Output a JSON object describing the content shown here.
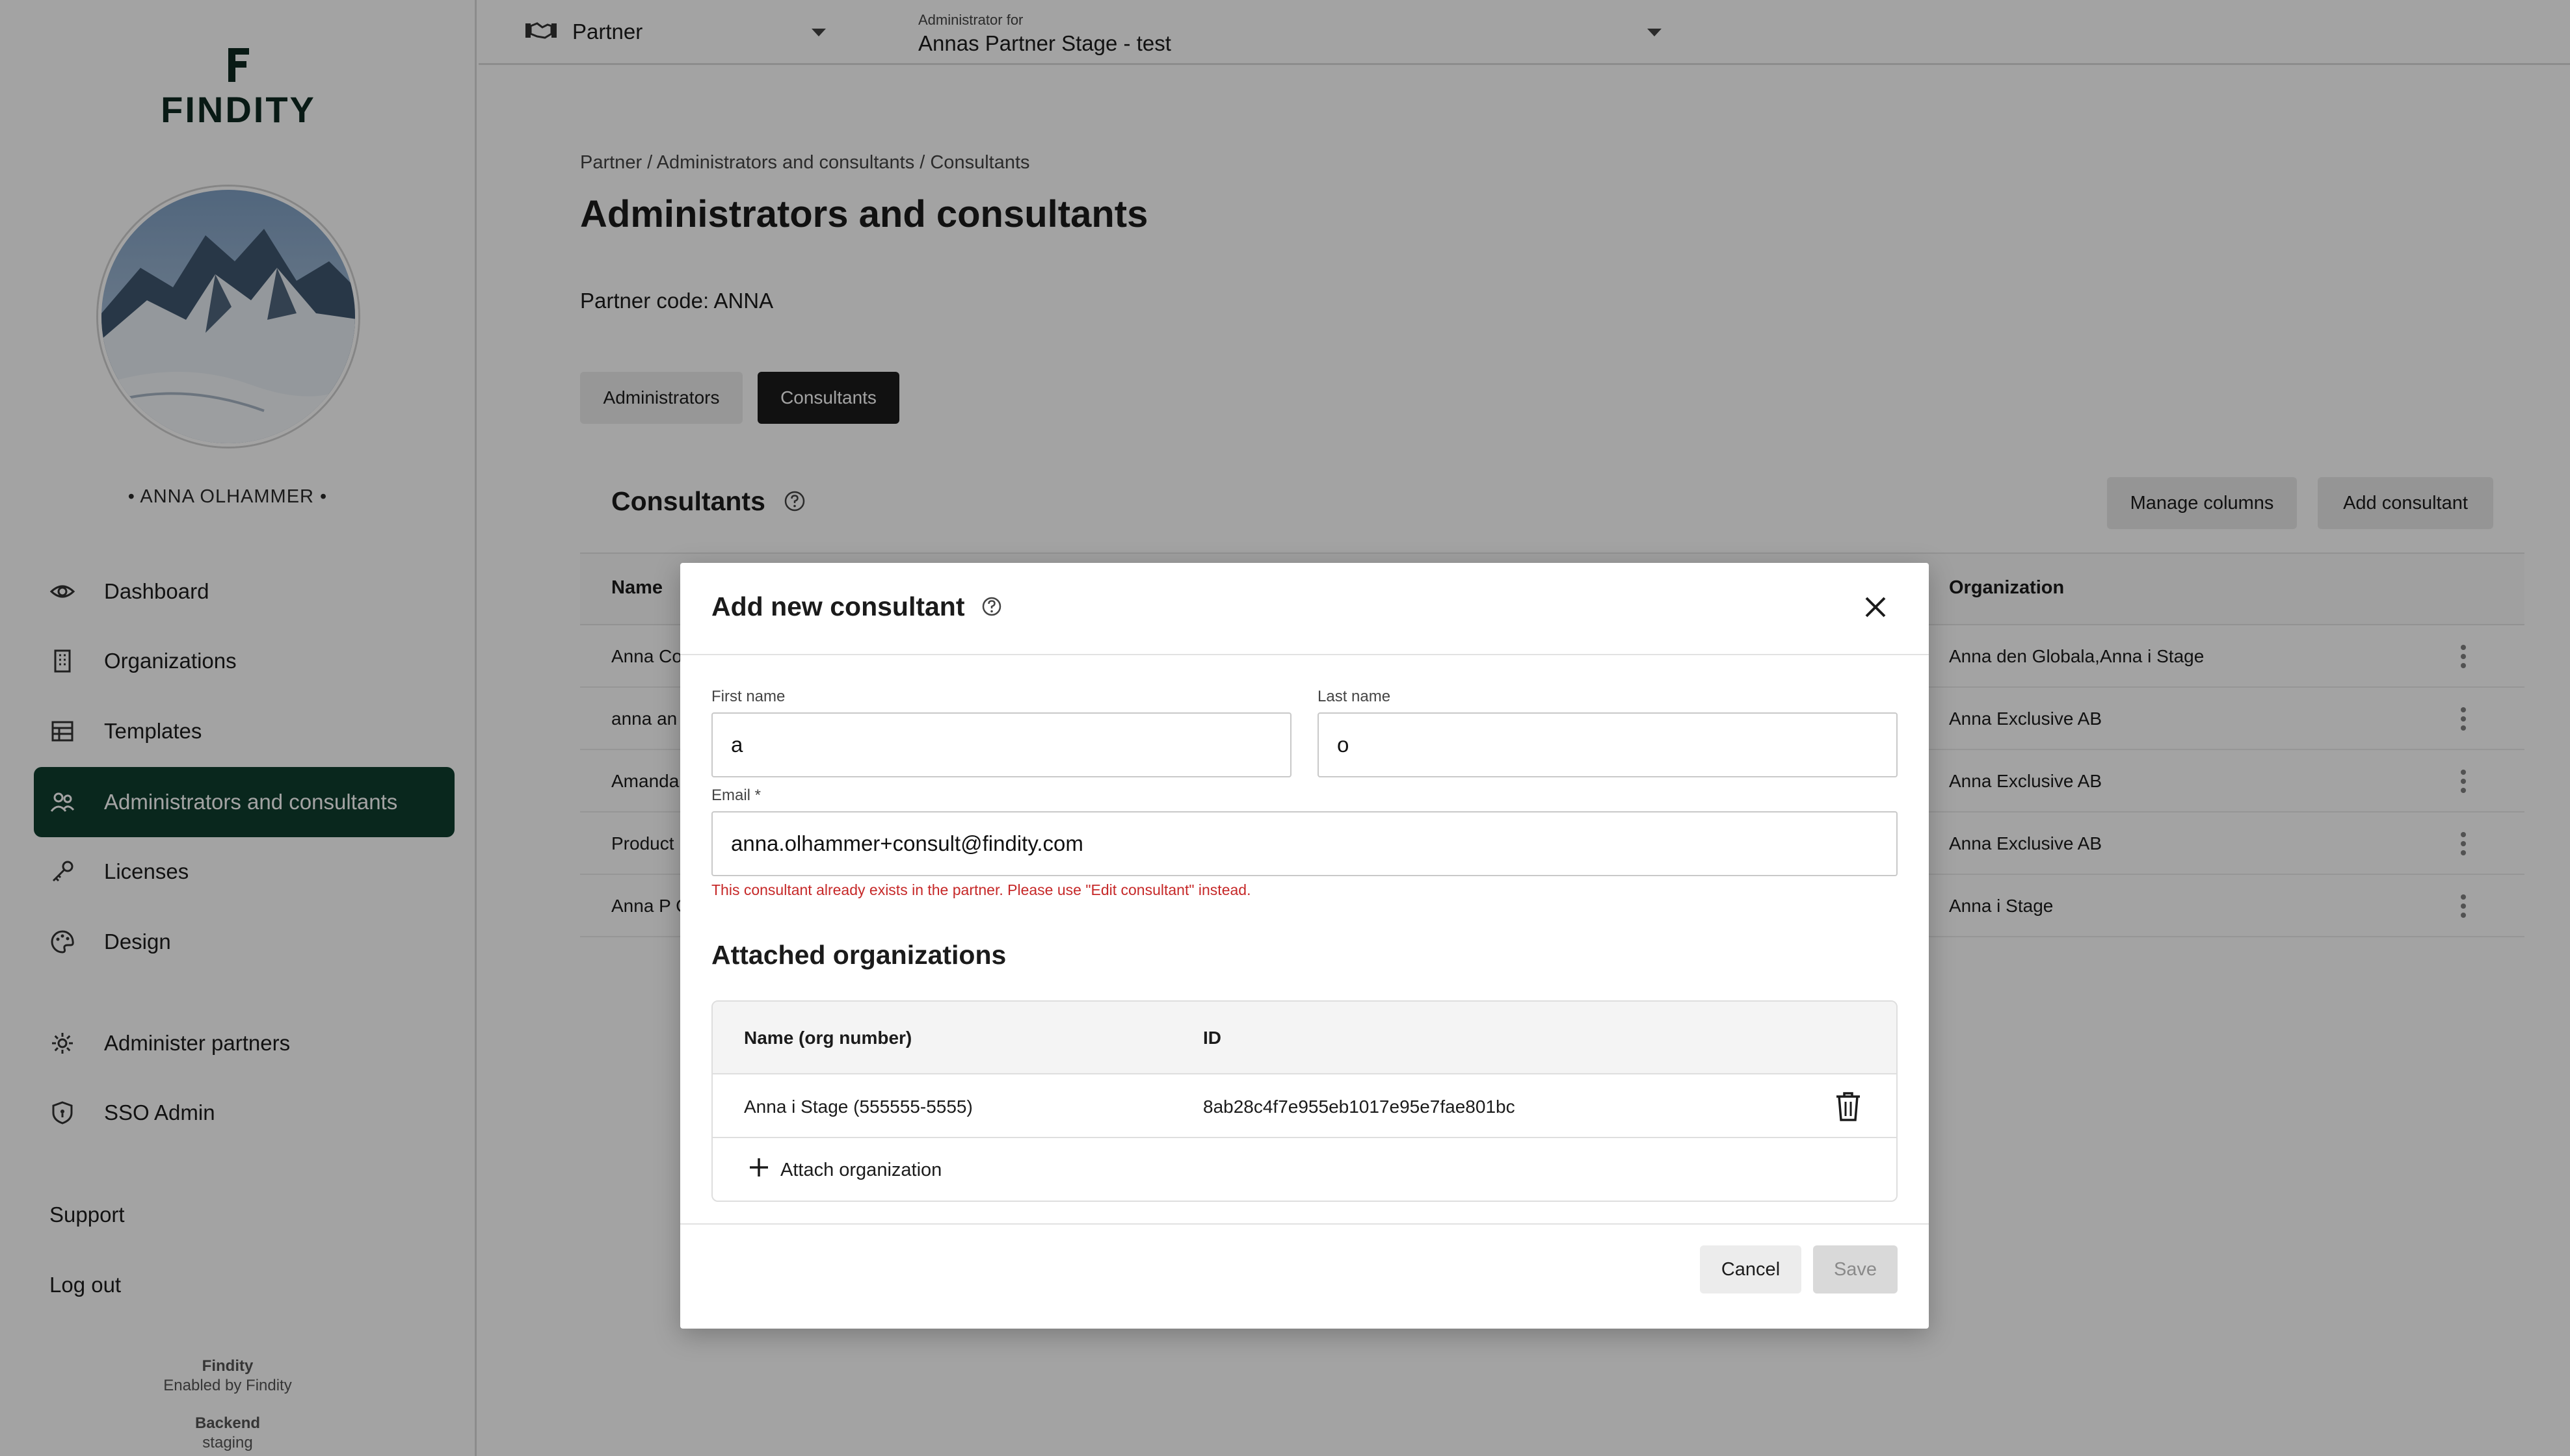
{
  "app": {
    "brand": "FINDITY",
    "accent_color": "#0f3d2e"
  },
  "sidebar": {
    "user_name": "• ANNA OLHAMMER •",
    "nav": [
      {
        "label": "Dashboard",
        "icon": "eye-icon"
      },
      {
        "label": "Organizations",
        "icon": "building-icon"
      },
      {
        "label": "Templates",
        "icon": "table-icon"
      },
      {
        "label": "Administrators and consultants",
        "icon": "users-icon",
        "active": true
      },
      {
        "label": "Licenses",
        "icon": "key-icon"
      },
      {
        "label": "Design",
        "icon": "palette-icon"
      },
      {
        "label": "Administer partners",
        "icon": "gear-icon"
      },
      {
        "label": "SSO Admin",
        "icon": "shield-icon"
      }
    ],
    "support": "Support",
    "logout": "Log out",
    "footer": {
      "app_name": "Findity",
      "enabled_by": "Enabled by Findity",
      "backend_label": "Backend",
      "backend_value": "staging"
    }
  },
  "topbar": {
    "context": "Partner",
    "admin_for_label": "Administrator for",
    "admin_for_value": "Annas Partner Stage - test"
  },
  "main": {
    "breadcrumb": "Partner / Administrators and consultants / Consultants",
    "title": "Administrators and consultants",
    "partner_code": "Partner code: ANNA",
    "tabs": [
      {
        "label": "Administrators",
        "active": false
      },
      {
        "label": "Consultants",
        "active": true
      }
    ],
    "card": {
      "title": "Consultants",
      "manage_columns": "Manage columns",
      "add_consultant": "Add consultant",
      "columns": {
        "name": "Name",
        "organization": "Organization"
      },
      "rows": [
        {
          "name": "Anna Co",
          "organization": "Anna den Globala,Anna i Stage"
        },
        {
          "name": "anna an",
          "organization": "Anna Exclusive AB"
        },
        {
          "name": "Amanda",
          "organization": "Anna Exclusive AB"
        },
        {
          "name": "Product",
          "organization": "Anna Exclusive AB"
        },
        {
          "name": "Anna P C",
          "organization": "Anna i Stage"
        }
      ]
    }
  },
  "modal": {
    "title": "Add new consultant",
    "first_name_label": "First name",
    "first_name_value": "a",
    "last_name_label": "Last name",
    "last_name_value": "o",
    "email_label": "Email *",
    "email_value": "anna.olhammer+consult@findity.com",
    "email_error": "This consultant already exists in the partner. Please use \"Edit consultant\" instead.",
    "attached_title": "Attached organizations",
    "org_columns": {
      "name": "Name (org number)",
      "id": "ID"
    },
    "orgs": [
      {
        "name": "Anna i Stage (555555-5555)",
        "id": "8ab28c4f7e955eb1017e95e7fae801bc"
      }
    ],
    "attach_label": "Attach organization",
    "cancel": "Cancel",
    "save": "Save",
    "error_color": "#c62828"
  }
}
